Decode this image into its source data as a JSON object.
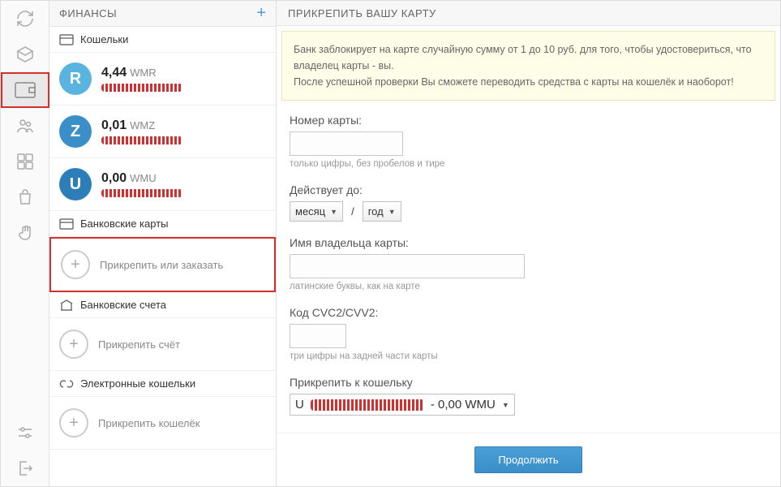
{
  "sidebar": {
    "title": "ФИНАНСЫ",
    "sections": {
      "wallets": "Кошельки",
      "cards": "Банковские карты",
      "accounts": "Банковские счета",
      "ewallets": "Электронные кошельки"
    },
    "wallets": [
      {
        "letter": "R",
        "balance": "4,44",
        "currency": "WMR"
      },
      {
        "letter": "Z",
        "balance": "0,01",
        "currency": "WMZ"
      },
      {
        "letter": "U",
        "balance": "0,00",
        "currency": "WMU"
      }
    ],
    "actions": {
      "attach_card": "Прикрепить или заказать",
      "attach_account": "Прикрепить счёт",
      "attach_ewallet": "Прикрепить кошелёк"
    }
  },
  "main": {
    "title": "ПРИКРЕПИТЬ ВАШУ КАРТУ",
    "info_line1": "Банк заблокирует на карте случайную сумму от 1 до 10 руб. для того, чтобы удостовериться, что владелец карты - вы.",
    "info_line2": "После успешной проверки Вы сможете переводить средства с карты на кошелёк и наоборот!",
    "form": {
      "card_number_label": "Номер карты:",
      "card_number_hint": "только цифры, без пробелов и тире",
      "expiry_label": "Действует до:",
      "expiry_month": "месяц",
      "expiry_year": "год",
      "name_label": "Имя владельца карты:",
      "name_hint": "латинские буквы, как на карте",
      "cvc_label": "Код CVC2/CVV2:",
      "cvc_hint": "три цифры на задней части карты",
      "wallet_label": "Прикрепить к кошельку",
      "wallet_prefix": "U",
      "wallet_suffix": "- 0,00 WMU",
      "submit": "Продолжить"
    }
  }
}
